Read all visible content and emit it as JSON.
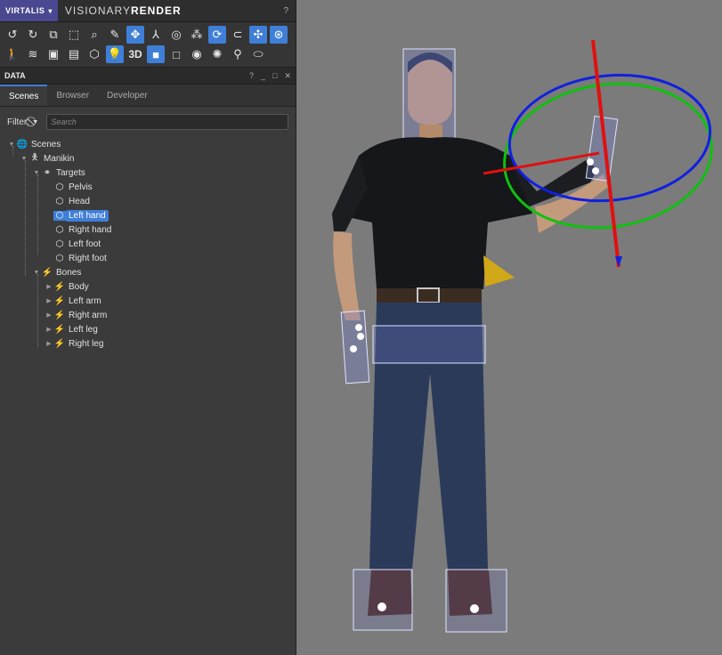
{
  "app": {
    "brand": "VIRTALIS",
    "name_light": "VISIONARY",
    "name_bold": "RENDER",
    "help": "?"
  },
  "toolbar": {
    "row1": [
      {
        "icon": "undo-icon",
        "glyph": "↺",
        "on": false
      },
      {
        "icon": "redo-icon",
        "glyph": "↻",
        "on": false
      },
      {
        "icon": "copy-icon",
        "glyph": "⧉",
        "on": false
      },
      {
        "icon": "select-box-icon",
        "glyph": "⬚",
        "on": false
      },
      {
        "icon": "zoom-select-icon",
        "glyph": "⌕",
        "on": false
      },
      {
        "icon": "edit-icon",
        "glyph": "✎",
        "on": false
      },
      {
        "icon": "move-gizmo-icon",
        "glyph": "✥",
        "on": true
      },
      {
        "icon": "axes-icon",
        "glyph": "⅄",
        "on": false
      },
      {
        "icon": "sphere-icon",
        "glyph": "◎",
        "on": false
      },
      {
        "icon": "nodes-icon",
        "glyph": "⁂",
        "on": false
      },
      {
        "icon": "rotate-icon",
        "glyph": "⟳",
        "on": true
      },
      {
        "icon": "magnet-icon",
        "glyph": "⊂",
        "on": false
      },
      {
        "icon": "orbit-icon",
        "glyph": "✣",
        "on": true
      },
      {
        "icon": "orbit-lock-icon",
        "glyph": "⊛",
        "on": true
      }
    ],
    "row2": [
      {
        "icon": "walk-icon",
        "glyph": "🚶",
        "on": false
      },
      {
        "icon": "wifi-icon",
        "glyph": "≋",
        "on": false
      },
      {
        "icon": "screen-icon",
        "glyph": "▣",
        "on": false
      },
      {
        "icon": "document-icon",
        "glyph": "▤",
        "on": false
      },
      {
        "icon": "cube-icon",
        "glyph": "⬡",
        "on": false
      },
      {
        "icon": "light-icon",
        "glyph": "💡",
        "on": true
      },
      {
        "icon": "3d-icon",
        "glyph": "3D",
        "on": false
      },
      {
        "icon": "fill-icon",
        "glyph": "■",
        "on": true
      },
      {
        "icon": "square-icon",
        "glyph": "□",
        "on": false
      },
      {
        "icon": "target-icon",
        "glyph": "◉",
        "on": false
      },
      {
        "icon": "aperture-icon",
        "glyph": "✺",
        "on": false
      },
      {
        "icon": "skeleton-icon",
        "glyph": "⚲",
        "on": false
      },
      {
        "icon": "vr-headset-icon",
        "glyph": "⬭",
        "on": false
      }
    ]
  },
  "panel": {
    "title": "DATA",
    "controls": [
      "?",
      "_",
      "□",
      "✕"
    ]
  },
  "tabs": [
    "Scenes",
    "Browser",
    "Developer"
  ],
  "filter": {
    "label": "Filter:",
    "placeholder": "Search"
  },
  "tree": [
    {
      "label": "Scenes",
      "level": 0,
      "icon": "globe-icon",
      "glyph": "🌐",
      "arrow": "▼",
      "sel": false
    },
    {
      "label": "Manikin",
      "level": 1,
      "icon": "person-icon",
      "glyph": "🯅",
      "arrow": "▼",
      "sel": false
    },
    {
      "label": "Targets",
      "level": 2,
      "icon": "targets-icon",
      "glyph": "⚭",
      "arrow": "▼",
      "sel": false
    },
    {
      "label": "Pelvis",
      "level": 3,
      "icon": "cube-icon",
      "glyph": "⬡",
      "arrow": "",
      "sel": false
    },
    {
      "label": "Head",
      "level": 3,
      "icon": "cube-icon",
      "glyph": "⬡",
      "arrow": "",
      "sel": false
    },
    {
      "label": "Left hand",
      "level": 3,
      "icon": "cube-icon",
      "glyph": "⬡",
      "arrow": "",
      "sel": true
    },
    {
      "label": "Right hand",
      "level": 3,
      "icon": "cube-icon",
      "glyph": "⬡",
      "arrow": "",
      "sel": false
    },
    {
      "label": "Left foot",
      "level": 3,
      "icon": "cube-icon",
      "glyph": "⬡",
      "arrow": "",
      "sel": false
    },
    {
      "label": "Right foot",
      "level": 3,
      "icon": "cube-icon",
      "glyph": "⬡",
      "arrow": "",
      "sel": false
    },
    {
      "label": "Bones",
      "level": 2,
      "icon": "bone-icon",
      "glyph": "⚡",
      "arrow": "▼",
      "sel": false
    },
    {
      "label": "Body",
      "level": 3,
      "icon": "bone-icon",
      "glyph": "⚡",
      "arrow": "▶",
      "sel": false
    },
    {
      "label": "Left arm",
      "level": 3,
      "icon": "bone-icon",
      "glyph": "⚡",
      "arrow": "▶",
      "sel": false
    },
    {
      "label": "Right arm",
      "level": 3,
      "icon": "bone-icon",
      "glyph": "⚡",
      "arrow": "▶",
      "sel": false
    },
    {
      "label": "Left leg",
      "level": 3,
      "icon": "bone-icon",
      "glyph": "⚡",
      "arrow": "▶",
      "sel": false
    },
    {
      "label": "Right leg",
      "level": 3,
      "icon": "bone-icon",
      "glyph": "⚡",
      "arrow": "▶",
      "sel": false
    }
  ],
  "colors": {
    "accent": "#3f7fd8",
    "brand": "#4a4890",
    "gizmo_x": "#e01010",
    "gizmo_y": "#10c010",
    "gizmo_z": "#1020e0"
  }
}
